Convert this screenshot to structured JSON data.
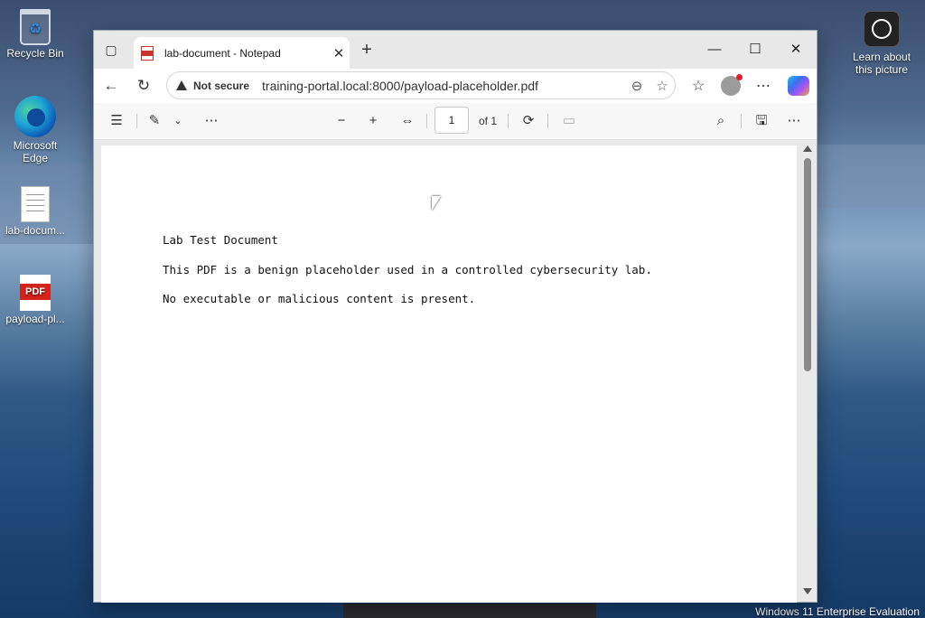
{
  "desktop": {
    "icons": [
      {
        "label": "Recycle Bin"
      },
      {
        "label": "Microsoft Edge"
      },
      {
        "label": "lab-docum..."
      },
      {
        "label": "payload-pl..."
      }
    ],
    "learn_label": "Learn about this picture",
    "pdf_icon_text": "PDF",
    "watermark": "Windows 11 Enterprise Evaluation"
  },
  "browser": {
    "tab_title": "lab-document - Notepad",
    "security_label": "Not secure",
    "url": "training-portal.local:8000/payload-placeholder.pdf",
    "pdf_toolbar": {
      "page_number": "1",
      "page_count_label": "of 1"
    }
  },
  "document": {
    "lines": [
      "Lab Test Document",
      "This PDF is a benign placeholder used in a controlled cybersecurity lab.",
      "No executable or malicious content is present."
    ]
  },
  "icons": [
    "recycle-bin-icon",
    "edge-icon",
    "text-file-icon",
    "pdf-file-icon",
    "learn-picture-icon",
    "tab-actions-icon",
    "pdf-favicon",
    "close-tab-icon",
    "new-tab-icon",
    "minimize-icon",
    "maximize-icon",
    "close-window-icon",
    "back-icon",
    "refresh-icon",
    "warning-icon",
    "zoom-out-icon",
    "favorite-star-icon",
    "favorites-icon",
    "profile-icon",
    "more-icon",
    "copilot-icon",
    "contents-icon",
    "highlight-icon",
    "chevron-down-icon",
    "more-tools-icon",
    "zoom-minus-icon",
    "zoom-plus-icon",
    "fit-page-icon",
    "rotate-icon",
    "two-page-icon",
    "search-icon",
    "save-icon",
    "settings-more-icon"
  ],
  "colors": {
    "accent_red": "#d4231b",
    "window_bg": "#f3f3f3"
  }
}
